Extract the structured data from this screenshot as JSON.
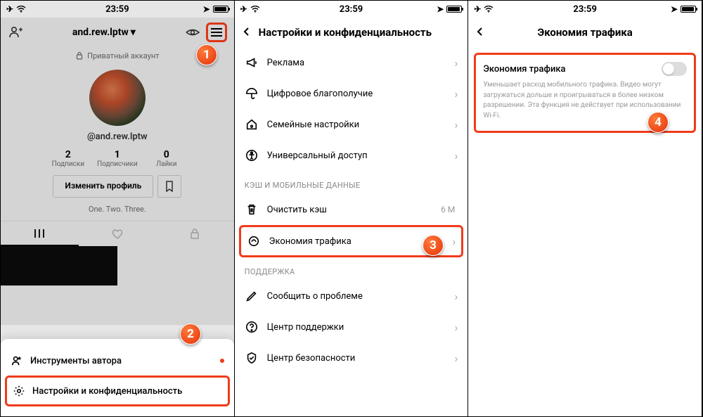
{
  "status": {
    "time": "23:59"
  },
  "phone1": {
    "username": "and.rew.lptw",
    "private_label": "Приватный аккаунт",
    "handle": "@and.rew.lptw",
    "stats": {
      "subs_count": "2",
      "subs_label": "Подписки",
      "followers_count": "1",
      "followers_label": "Подписчики",
      "likes_count": "0",
      "likes_label": "Лайки"
    },
    "edit_label": "Изменить профиль",
    "bio": "One. Two. Three.",
    "popup": {
      "item1": "Инструменты автора",
      "item2": "Настройки и конфиденциальность"
    }
  },
  "phone2": {
    "title": "Настройки и конфиденциальность",
    "section_cache": "КЭШ И МОБИЛЬНЫЕ ДАННЫЕ",
    "section_support": "ПОДДЕРЖКА",
    "rows": {
      "ads": "Реклама",
      "wellbeing": "Цифровое благополучие",
      "family": "Семейные настройки",
      "accessibility": "Универсальный доступ",
      "clear_cache": "Очистить кэш",
      "cache_size": "6 M",
      "data_saver": "Экономия трафика",
      "report": "Сообщить о проблеме",
      "help": "Центр поддержки",
      "safety": "Центр безопасности"
    }
  },
  "phone3": {
    "title": "Экономия трафика",
    "switch_label": "Экономия трафика",
    "description": "Уменьшает расход мобильного трафика. Видео могут загружаться дольше и проигрываться в более низком разрешении. Эта функция не действует при использовании Wi-Fi."
  },
  "steps": {
    "s1": "1",
    "s2": "2",
    "s3": "3",
    "s4": "4"
  }
}
